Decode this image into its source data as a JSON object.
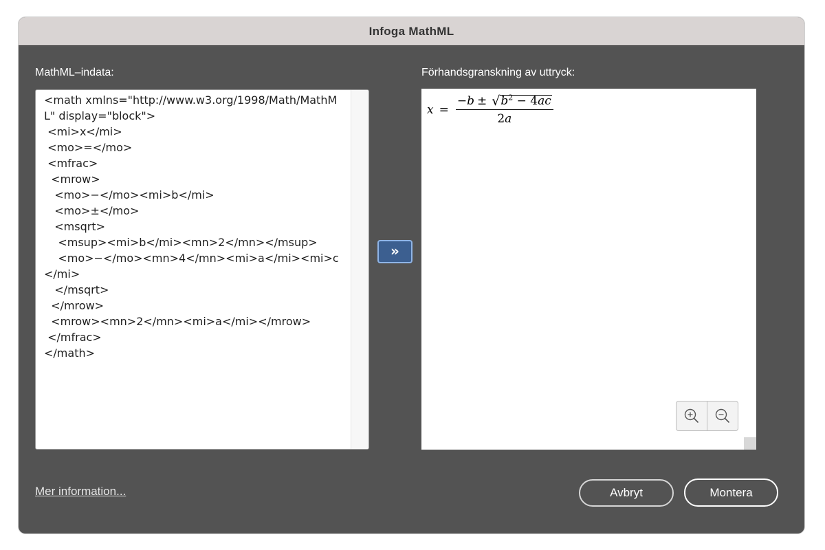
{
  "dialog": {
    "title": "Infoga MathML",
    "input_label": "MathML–indata:",
    "preview_label": "Förhandsgranskning av uttryck:",
    "mathml_code": "<math xmlns=\"http://www.w3.org/1998/Math/MathML\" display=\"block\">\n <mi>x</mi>\n <mo>=</mo>\n <mfrac>\n  <mrow>\n   <mo>−</mo><mi>b</mi>\n   <mo>±</mo>\n   <msqrt>\n    <msup><mi>b</mi><mn>2</mn></msup>\n    <mo>−</mo><mn>4</mn><mi>a</mi><mi>c</mi>\n   </msqrt>\n  </mrow>\n  <mrow><mn>2</mn><mi>a</mi></mrow>\n </mfrac>\n</math>",
    "convert_button_glyph": "»",
    "more_info_link": "Mer information...",
    "cancel_button": "Avbryt",
    "ok_button": "Montera"
  },
  "preview": {
    "lhs": "x",
    "equals": "=",
    "numerator": {
      "minus": "−",
      "b": "b",
      "plus_minus": "±",
      "radical": "√",
      "radicand_b": "b",
      "exponent": "2",
      "radicand_rest": " − 4",
      "a": "a",
      "c": "c"
    },
    "denominator": {
      "two": "2",
      "a": "a"
    }
  },
  "icons": {
    "zoom_in": "zoom-in-icon",
    "zoom_out": "zoom-out-icon"
  },
  "colors": {
    "dialog_bg": "#535353",
    "titlebar_bg": "#d9d4d3",
    "accent_button": "#3c5f90"
  }
}
